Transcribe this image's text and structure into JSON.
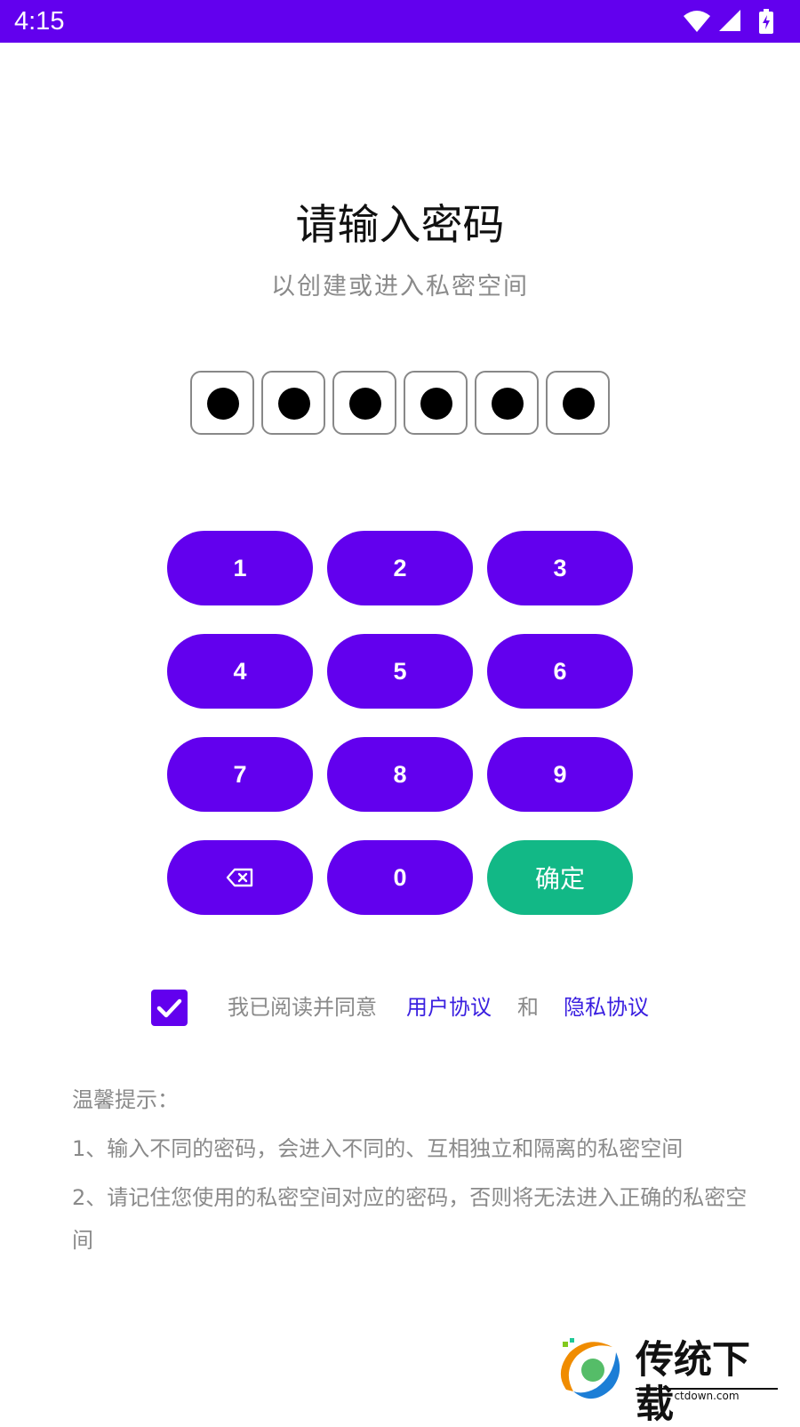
{
  "status_bar": {
    "time": "4:15",
    "icons": [
      "wifi-icon",
      "cell-signal-icon",
      "battery-charging-icon"
    ],
    "color": "#6200ee"
  },
  "header": {
    "title": "请输入密码",
    "subtitle": "以创建或进入私密空间"
  },
  "pin": {
    "length": 6,
    "filled": 6
  },
  "keypad": {
    "keys": [
      "1",
      "2",
      "3",
      "4",
      "5",
      "6",
      "7",
      "8",
      "9",
      "⌫",
      "0",
      "确定"
    ],
    "key_color": "#6200ee",
    "confirm_color": "#12b886",
    "backspace_icon": "backspace-icon"
  },
  "agreement": {
    "checked": true,
    "prefix": "我已阅读并同意",
    "user_agreement": "用户协议",
    "and": "和",
    "privacy_agreement": "隐私协议"
  },
  "tips": {
    "heading": "温馨提示：",
    "items": [
      "1、输入不同的密码，会进入不同的、互相独立和隔离的私密空间",
      "2、请记住您使用的私密空间对应的密码，否则将无法进入正确的私密空间"
    ]
  },
  "watermark": {
    "text": "传统下载",
    "domain": "ctdown.com"
  }
}
